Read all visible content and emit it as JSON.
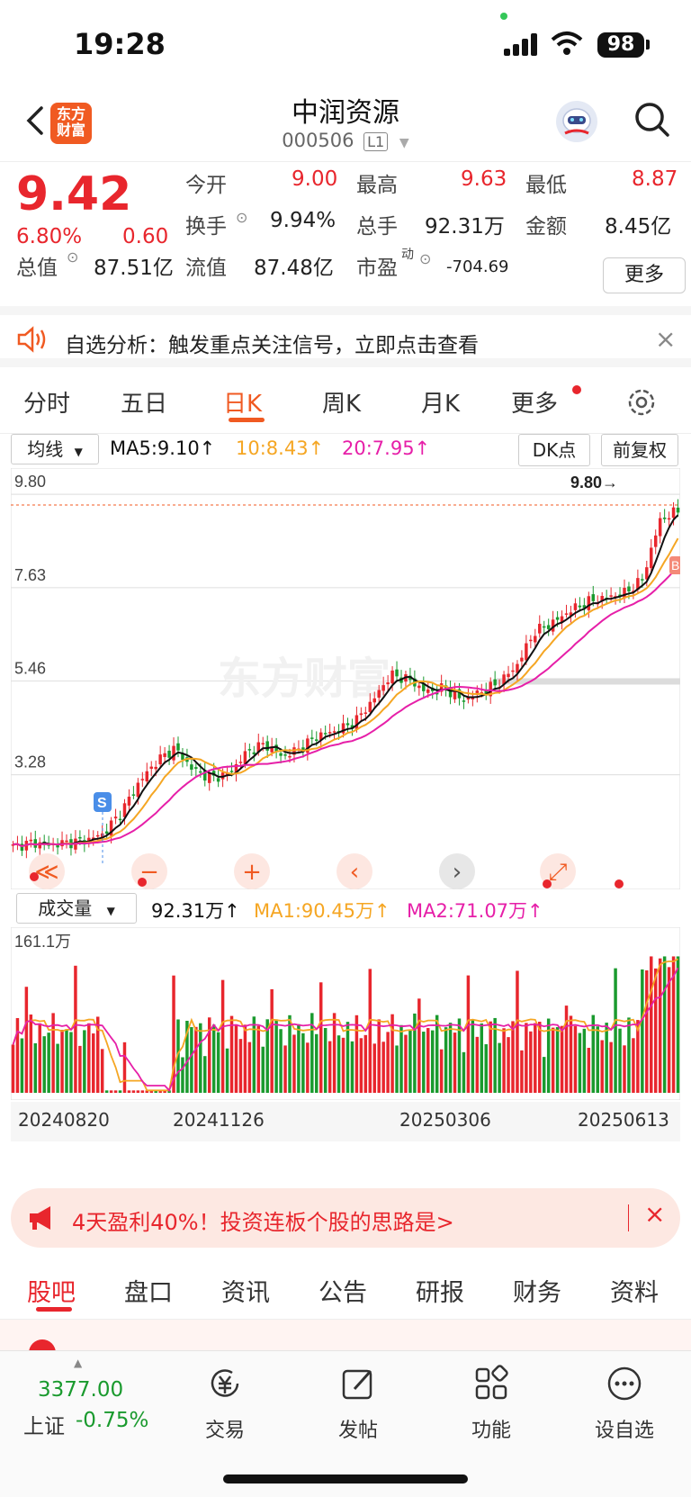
{
  "status": {
    "time": "19:28",
    "battery": "98"
  },
  "header": {
    "name": "中润资源",
    "code": "000506",
    "level": "L1",
    "logo": "东方\n财富"
  },
  "quote": {
    "price": "9.42",
    "change_pct": "6.80%",
    "change_amt": "0.60",
    "open_label": "今开",
    "open": "9.00",
    "high_label": "最高",
    "high": "9.63",
    "low_label": "最低",
    "low": "8.87",
    "turnover_label": "换手",
    "turnover": "9.94%",
    "volume_label": "总手",
    "volume": "92.31万",
    "amount_label": "金额",
    "amount": "8.45亿",
    "mktcap_label": "总值",
    "mktcap": "87.51亿",
    "float_label": "流值",
    "float": "87.48亿",
    "pe_label": "市盈",
    "pe_sup": "动",
    "pe": "-704.69",
    "more": "更多"
  },
  "notice": {
    "text": "自选分析：触发重点关注信号，立即点击查看",
    "close": "×"
  },
  "ktabs": [
    "分时",
    "五日",
    "日K",
    "周K",
    "月K",
    "更多"
  ],
  "chart": {
    "ma_selector": "均线",
    "ma5": "MA5:9.10↑",
    "ma10": "10:8.43↑",
    "ma20": "20:7.95↑",
    "dk": "DK点",
    "adjust": "前复权",
    "price_ticks": [
      "9.80",
      "7.63",
      "5.46",
      "3.28"
    ],
    "max_label": "9.80→",
    "s_marker": "S",
    "b_marker": "B",
    "watermark": "东方财富",
    "vol_selector": "成交量",
    "vol_value": "92.31万↑",
    "vol_ma1": "MA1:90.45万↑",
    "vol_ma2": "MA2:71.07万↑",
    "vol_max": "161.1万",
    "dates": [
      "20240820",
      "20241126",
      "20250306",
      "20250613"
    ],
    "colors": {
      "up": "#e8262d",
      "down": "#1a9a2e",
      "ma5": "#111111",
      "ma10": "#f5a623",
      "ma20": "#e61fa8"
    }
  },
  "chart_data": {
    "type": "candlestick",
    "price_ticks": [
      9.8,
      7.63,
      5.46,
      3.28
    ],
    "ma5": 9.1,
    "ma10": 8.43,
    "ma20": 7.95,
    "close_trend": [
      1.6,
      1.7,
      1.65,
      1.7,
      1.75,
      1.9,
      2.4,
      3.1,
      3.6,
      3.9,
      3.4,
      3.2,
      3.3,
      3.8,
      4.0,
      3.7,
      3.9,
      4.2,
      4.3,
      4.5,
      5.0,
      5.6,
      5.5,
      5.2,
      5.3,
      5.0,
      5.2,
      5.4,
      5.8,
      6.6,
      6.8,
      7.1,
      7.3,
      7.4,
      7.5,
      7.8,
      9.2,
      9.42
    ],
    "dates": [
      "20240820",
      "20241126",
      "20250306",
      "20250613"
    ],
    "vol_max": "161.1万"
  },
  "ad": {
    "text": "4天盈利40%！投资连板个股的思路是>",
    "close": "×"
  },
  "btabs": [
    "股吧",
    "盘口",
    "资讯",
    "公告",
    "研报",
    "财务",
    "资料"
  ],
  "bottom": {
    "index_value": "3377.00",
    "index_name": "上证",
    "index_pct": "-0.75%",
    "trade": "交易",
    "post": "发帖",
    "func": "功能",
    "watch": "设自选"
  }
}
